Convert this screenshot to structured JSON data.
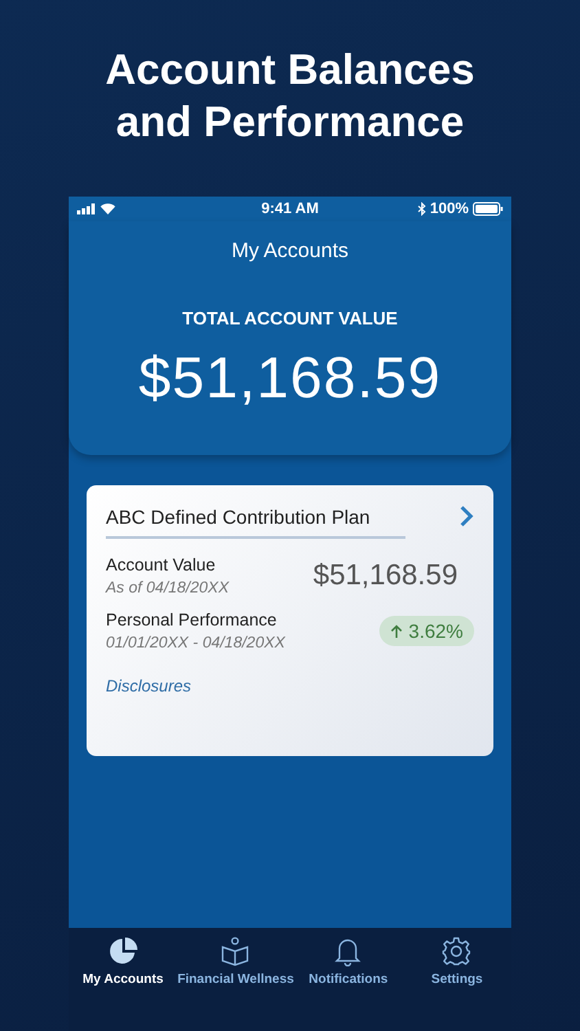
{
  "headline": [
    "Account Balances",
    "and Performance"
  ],
  "status_bar": {
    "time": "9:41 AM",
    "battery": "100%"
  },
  "header": {
    "title": "My Accounts",
    "total_label": "TOTAL ACCOUNT VALUE",
    "total_value": "$51,168.59"
  },
  "account_card": {
    "plan_name": "ABC Defined Contribution Plan",
    "value_label": "Account Value",
    "value_date": "As of 04/18/20XX",
    "value": "$51,168.59",
    "performance_label": "Personal Performance",
    "performance_range": "01/01/20XX - 04/18/20XX",
    "performance": "3.62%",
    "performance_up": true,
    "disclosures_link": "Disclosures"
  },
  "tabs": [
    {
      "kind": "accounts",
      "label": "My Accounts",
      "selected": true
    },
    {
      "kind": "wellness",
      "label": "Financial Wellness",
      "selected": false
    },
    {
      "kind": "notifications",
      "label": "Notifications",
      "selected": false
    },
    {
      "kind": "settings",
      "label": "Settings",
      "selected": false
    }
  ]
}
